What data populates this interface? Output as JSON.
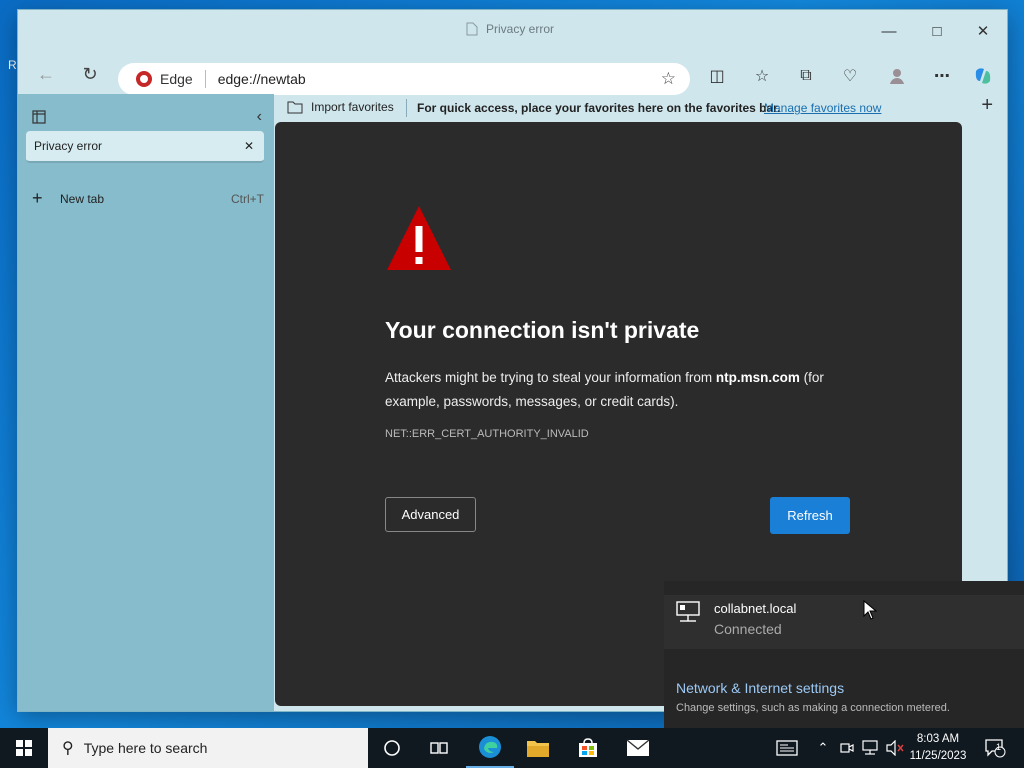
{
  "window": {
    "title": "Privacy error"
  },
  "toolbar": {
    "brand_label": "Edge",
    "url": "edge://newtab"
  },
  "favorites_bar": {
    "import_label": "Import favorites",
    "message": "For quick access, place your favorites here on the favorites bar.",
    "manage_link": "Manage favorites now"
  },
  "sidebar": {
    "tabs": [
      {
        "label": "Privacy error"
      }
    ],
    "new_tab_label": "New tab",
    "new_tab_shortcut": "Ctrl+T"
  },
  "error_page": {
    "heading": "Your connection isn't private",
    "desc_prefix": "Attackers might be trying to steal your information from ",
    "desc_host": "ntp.msn.com",
    "desc_suffix": " (for example, passwords, messages, or credit cards).",
    "error_code": "NET::ERR_CERT_AUTHORITY_INVALID",
    "advanced_label": "Advanced",
    "refresh_label": "Refresh",
    "warning_color": "#c90000",
    "accent_color": "#1a7fd6"
  },
  "network_flyout": {
    "network_name": "collabnet.local",
    "status": "Connected",
    "settings_title": "Network & Internet settings",
    "settings_hint": "Change settings, such as making a connection metered."
  },
  "taskbar": {
    "search_placeholder": "Type here to search",
    "time": "8:03 AM",
    "date": "11/25/2023",
    "notification_count": "1"
  }
}
